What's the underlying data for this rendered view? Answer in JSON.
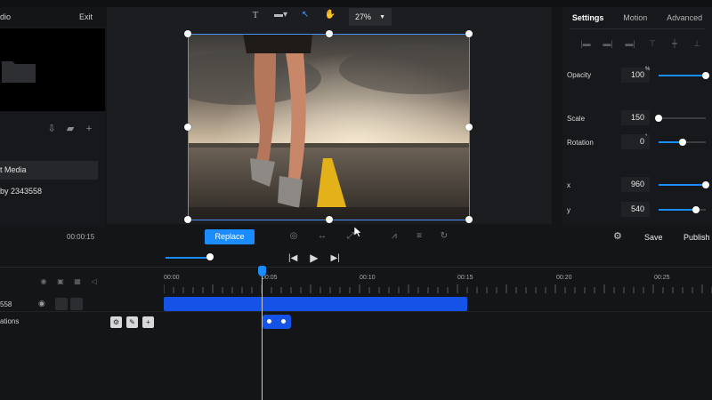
{
  "menu": {
    "media_label": "dio",
    "exit_label": "Exit"
  },
  "left_panel": {
    "media_items": [
      "t Media",
      "by 2343558"
    ]
  },
  "canvas": {
    "zoom": "27%",
    "replace_label": "Replace"
  },
  "right_panel": {
    "tabs": [
      {
        "label": "Settings",
        "active": true
      },
      {
        "label": "Motion",
        "active": false
      },
      {
        "label": "Advanced",
        "active": false
      }
    ],
    "properties": {
      "opacity": {
        "label": "Opacity",
        "value": "100",
        "unit": "%",
        "level": 1.0
      },
      "scale": {
        "label": "Scale",
        "value": "150",
        "level": 0.0
      },
      "rotation": {
        "label": "Rotation",
        "value": "0",
        "unit": "°",
        "level": 0.5
      },
      "x": {
        "label": "x",
        "value": "960",
        "level": 1.0
      },
      "y": {
        "label": "y",
        "value": "540",
        "level": 0.8
      }
    },
    "save_label": "Save",
    "publish_label": "Publish"
  },
  "playback": {
    "current_time": "00:00:15"
  },
  "timeline": {
    "tick_labels": [
      "00:00",
      "00:05",
      "00:10",
      "00:15",
      "00:20",
      "00:25"
    ],
    "track_label": "558",
    "animations_label": "ations"
  },
  "colors": {
    "accent": "#1a8cff",
    "clip": "#1552e8",
    "background": "#141517"
  }
}
